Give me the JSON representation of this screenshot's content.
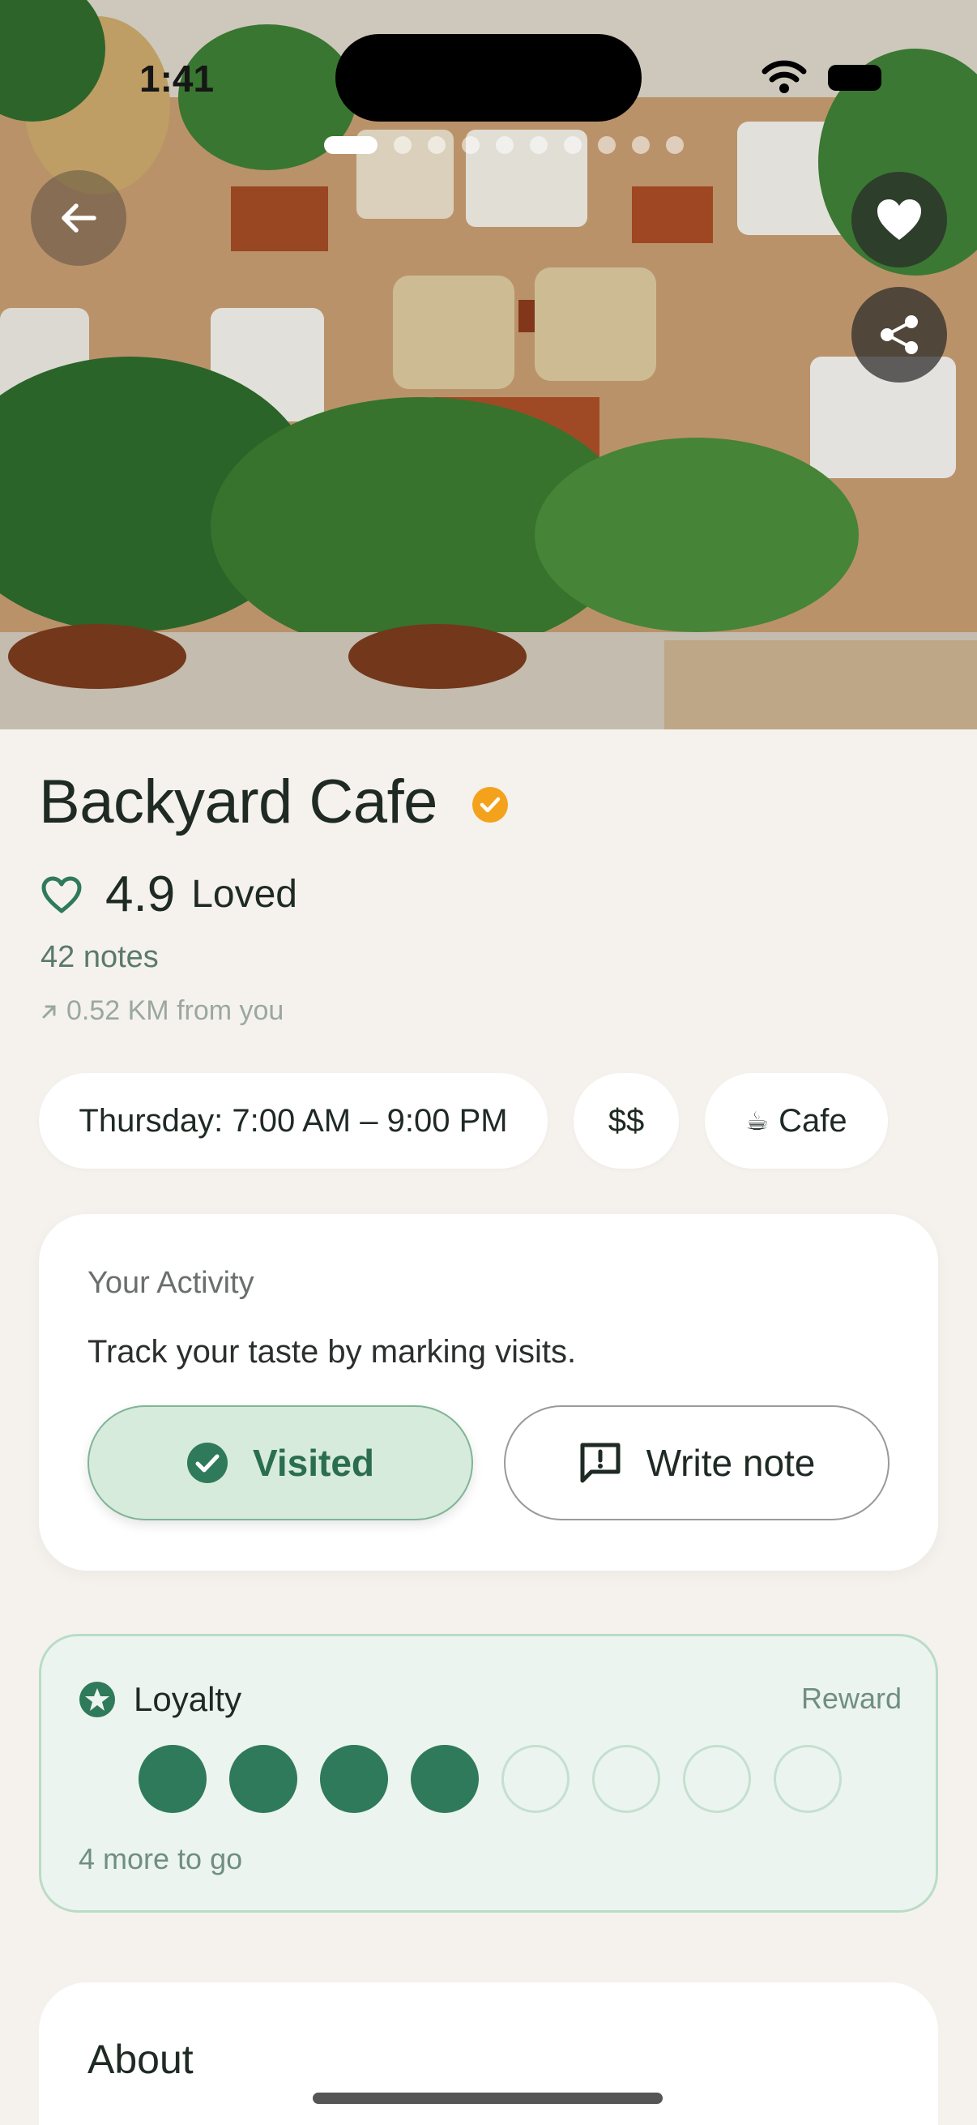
{
  "status_bar": {
    "time": "1:41"
  },
  "hero": {
    "image_alt": "Backyard Cafe interior with wicker chairs and palm plants",
    "carousel": {
      "total": 10,
      "active": 0
    }
  },
  "icons": {
    "back": "arrow-left-icon",
    "favorite": "heart-icon",
    "share": "share-icon",
    "verified": "verified-badge-icon",
    "rating": "heart-outline-icon",
    "distance": "arrow-up-right-icon",
    "visited": "check-circle-icon",
    "note": "comment-icon",
    "loyalty": "star-badge-icon"
  },
  "place": {
    "name": "Backyard Cafe",
    "rating": "4.9",
    "rating_label": "Loved",
    "notes": "42 notes",
    "distance": "0.52 KM from you"
  },
  "chips": {
    "hours": "Thursday: 7:00 AM – 9:00 PM",
    "price": "$$",
    "type_emoji": "☕",
    "type": "Cafe"
  },
  "activity": {
    "heading": "Your Activity",
    "description": "Track your taste by marking visits.",
    "visited_label": "Visited",
    "write_note_label": "Write note"
  },
  "loyalty": {
    "title": "Loyalty",
    "reward_label": "Reward",
    "stamps_total": 8,
    "stamps_filled": 4,
    "progress_text": "4 more to go"
  },
  "about": {
    "title": "About"
  },
  "colors": {
    "background": "#f5f2ed",
    "accent_green": "#2f7a5a",
    "verified_orange": "#f4a21c",
    "visited_bg": "#d6ebdc",
    "loyalty_bg": "#ecf4ef"
  }
}
